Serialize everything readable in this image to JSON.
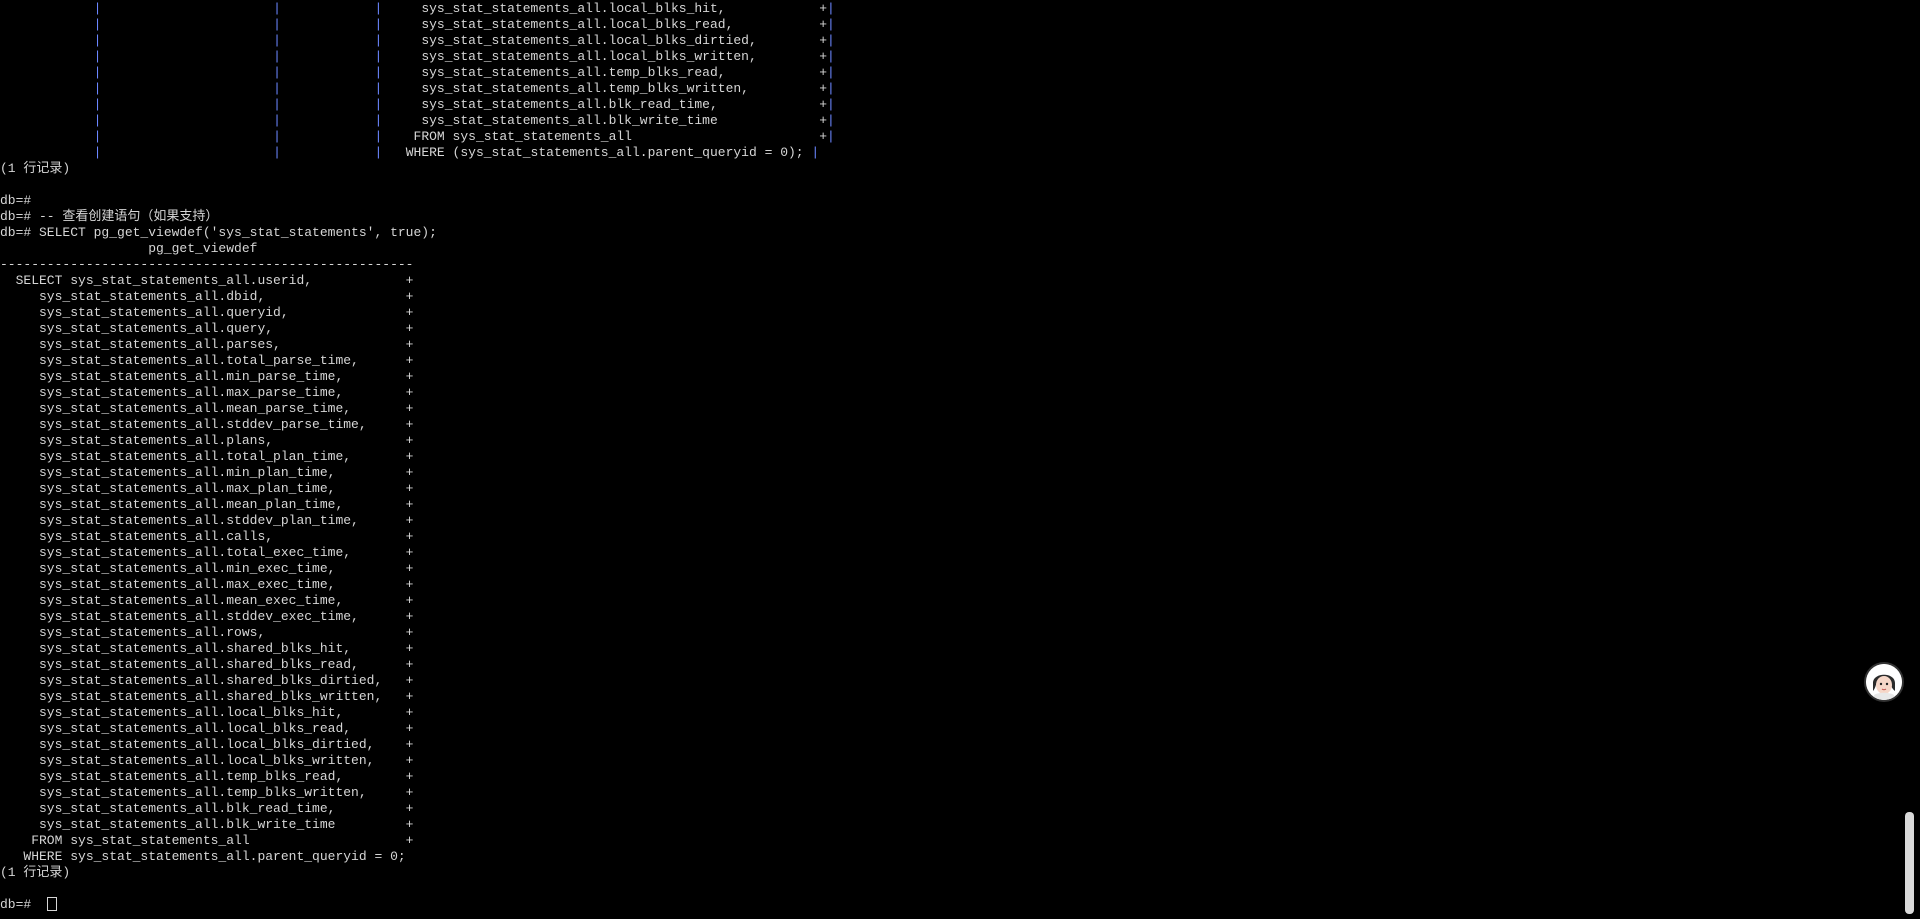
{
  "terminal": {
    "lines": [
      {
        "text": "            |                      |            |     sys_stat_statements_all.local_blks_hit,            +|"
      },
      {
        "text": "            |                      |            |     sys_stat_statements_all.local_blks_read,           +|"
      },
      {
        "text": "            |                      |            |     sys_stat_statements_all.local_blks_dirtied,        +|"
      },
      {
        "text": "            |                      |            |     sys_stat_statements_all.local_blks_written,        +|"
      },
      {
        "text": "            |                      |            |     sys_stat_statements_all.temp_blks_read,            +|"
      },
      {
        "text": "            |                      |            |     sys_stat_statements_all.temp_blks_written,         +|"
      },
      {
        "text": "            |                      |            |     sys_stat_statements_all.blk_read_time,             +|"
      },
      {
        "text": "            |                      |            |     sys_stat_statements_all.blk_write_time             +|"
      },
      {
        "text": "            |                      |            |    FROM sys_stat_statements_all                        +|"
      },
      {
        "text": "            |                      |            |   WHERE (sys_stat_statements_all.parent_queryid = 0); |"
      },
      {
        "text": "(1 行记录)"
      },
      {
        "text": ""
      },
      {
        "text": "db=#"
      },
      {
        "text": "db=# -- 查看创建语句（如果支持）"
      },
      {
        "text": "db=# SELECT pg_get_viewdef('sys_stat_statements', true);"
      },
      {
        "text": "                   pg_get_viewdef"
      },
      {
        "text": "-----------------------------------------------------"
      },
      {
        "text": "  SELECT sys_stat_statements_all.userid,            +"
      },
      {
        "text": "     sys_stat_statements_all.dbid,                  +"
      },
      {
        "text": "     sys_stat_statements_all.queryid,               +"
      },
      {
        "text": "     sys_stat_statements_all.query,                 +"
      },
      {
        "text": "     sys_stat_statements_all.parses,                +"
      },
      {
        "text": "     sys_stat_statements_all.total_parse_time,      +"
      },
      {
        "text": "     sys_stat_statements_all.min_parse_time,        +"
      },
      {
        "text": "     sys_stat_statements_all.max_parse_time,        +"
      },
      {
        "text": "     sys_stat_statements_all.mean_parse_time,       +"
      },
      {
        "text": "     sys_stat_statements_all.stddev_parse_time,     +"
      },
      {
        "text": "     sys_stat_statements_all.plans,                 +"
      },
      {
        "text": "     sys_stat_statements_all.total_plan_time,       +"
      },
      {
        "text": "     sys_stat_statements_all.min_plan_time,         +"
      },
      {
        "text": "     sys_stat_statements_all.max_plan_time,         +"
      },
      {
        "text": "     sys_stat_statements_all.mean_plan_time,        +"
      },
      {
        "text": "     sys_stat_statements_all.stddev_plan_time,      +"
      },
      {
        "text": "     sys_stat_statements_all.calls,                 +"
      },
      {
        "text": "     sys_stat_statements_all.total_exec_time,       +"
      },
      {
        "text": "     sys_stat_statements_all.min_exec_time,         +"
      },
      {
        "text": "     sys_stat_statements_all.max_exec_time,         +"
      },
      {
        "text": "     sys_stat_statements_all.mean_exec_time,        +"
      },
      {
        "text": "     sys_stat_statements_all.stddev_exec_time,      +"
      },
      {
        "text": "     sys_stat_statements_all.rows,                  +"
      },
      {
        "text": "     sys_stat_statements_all.shared_blks_hit,       +"
      },
      {
        "text": "     sys_stat_statements_all.shared_blks_read,      +"
      },
      {
        "text": "     sys_stat_statements_all.shared_blks_dirtied,   +"
      },
      {
        "text": "     sys_stat_statements_all.shared_blks_written,   +"
      },
      {
        "text": "     sys_stat_statements_all.local_blks_hit,        +"
      },
      {
        "text": "     sys_stat_statements_all.local_blks_read,       +"
      },
      {
        "text": "     sys_stat_statements_all.local_blks_dirtied,    +"
      },
      {
        "text": "     sys_stat_statements_all.local_blks_written,    +"
      },
      {
        "text": "     sys_stat_statements_all.temp_blks_read,        +"
      },
      {
        "text": "     sys_stat_statements_all.temp_blks_written,     +"
      },
      {
        "text": "     sys_stat_statements_all.blk_read_time,         +"
      },
      {
        "text": "     sys_stat_statements_all.blk_write_time         +"
      },
      {
        "text": "    FROM sys_stat_statements_all                    +"
      },
      {
        "text": "   WHERE sys_stat_statements_all.parent_queryid = 0;"
      },
      {
        "text": "(1 行记录)"
      },
      {
        "text": ""
      }
    ],
    "prompt": "db=#"
  },
  "colors": {
    "background": "#000000",
    "text": "#d6d6d6",
    "column_separator": "#6b86ff",
    "scroll_thumb": "#d9d9d9"
  },
  "icons": {
    "floating_assistant": "assistant-avatar-icon"
  }
}
